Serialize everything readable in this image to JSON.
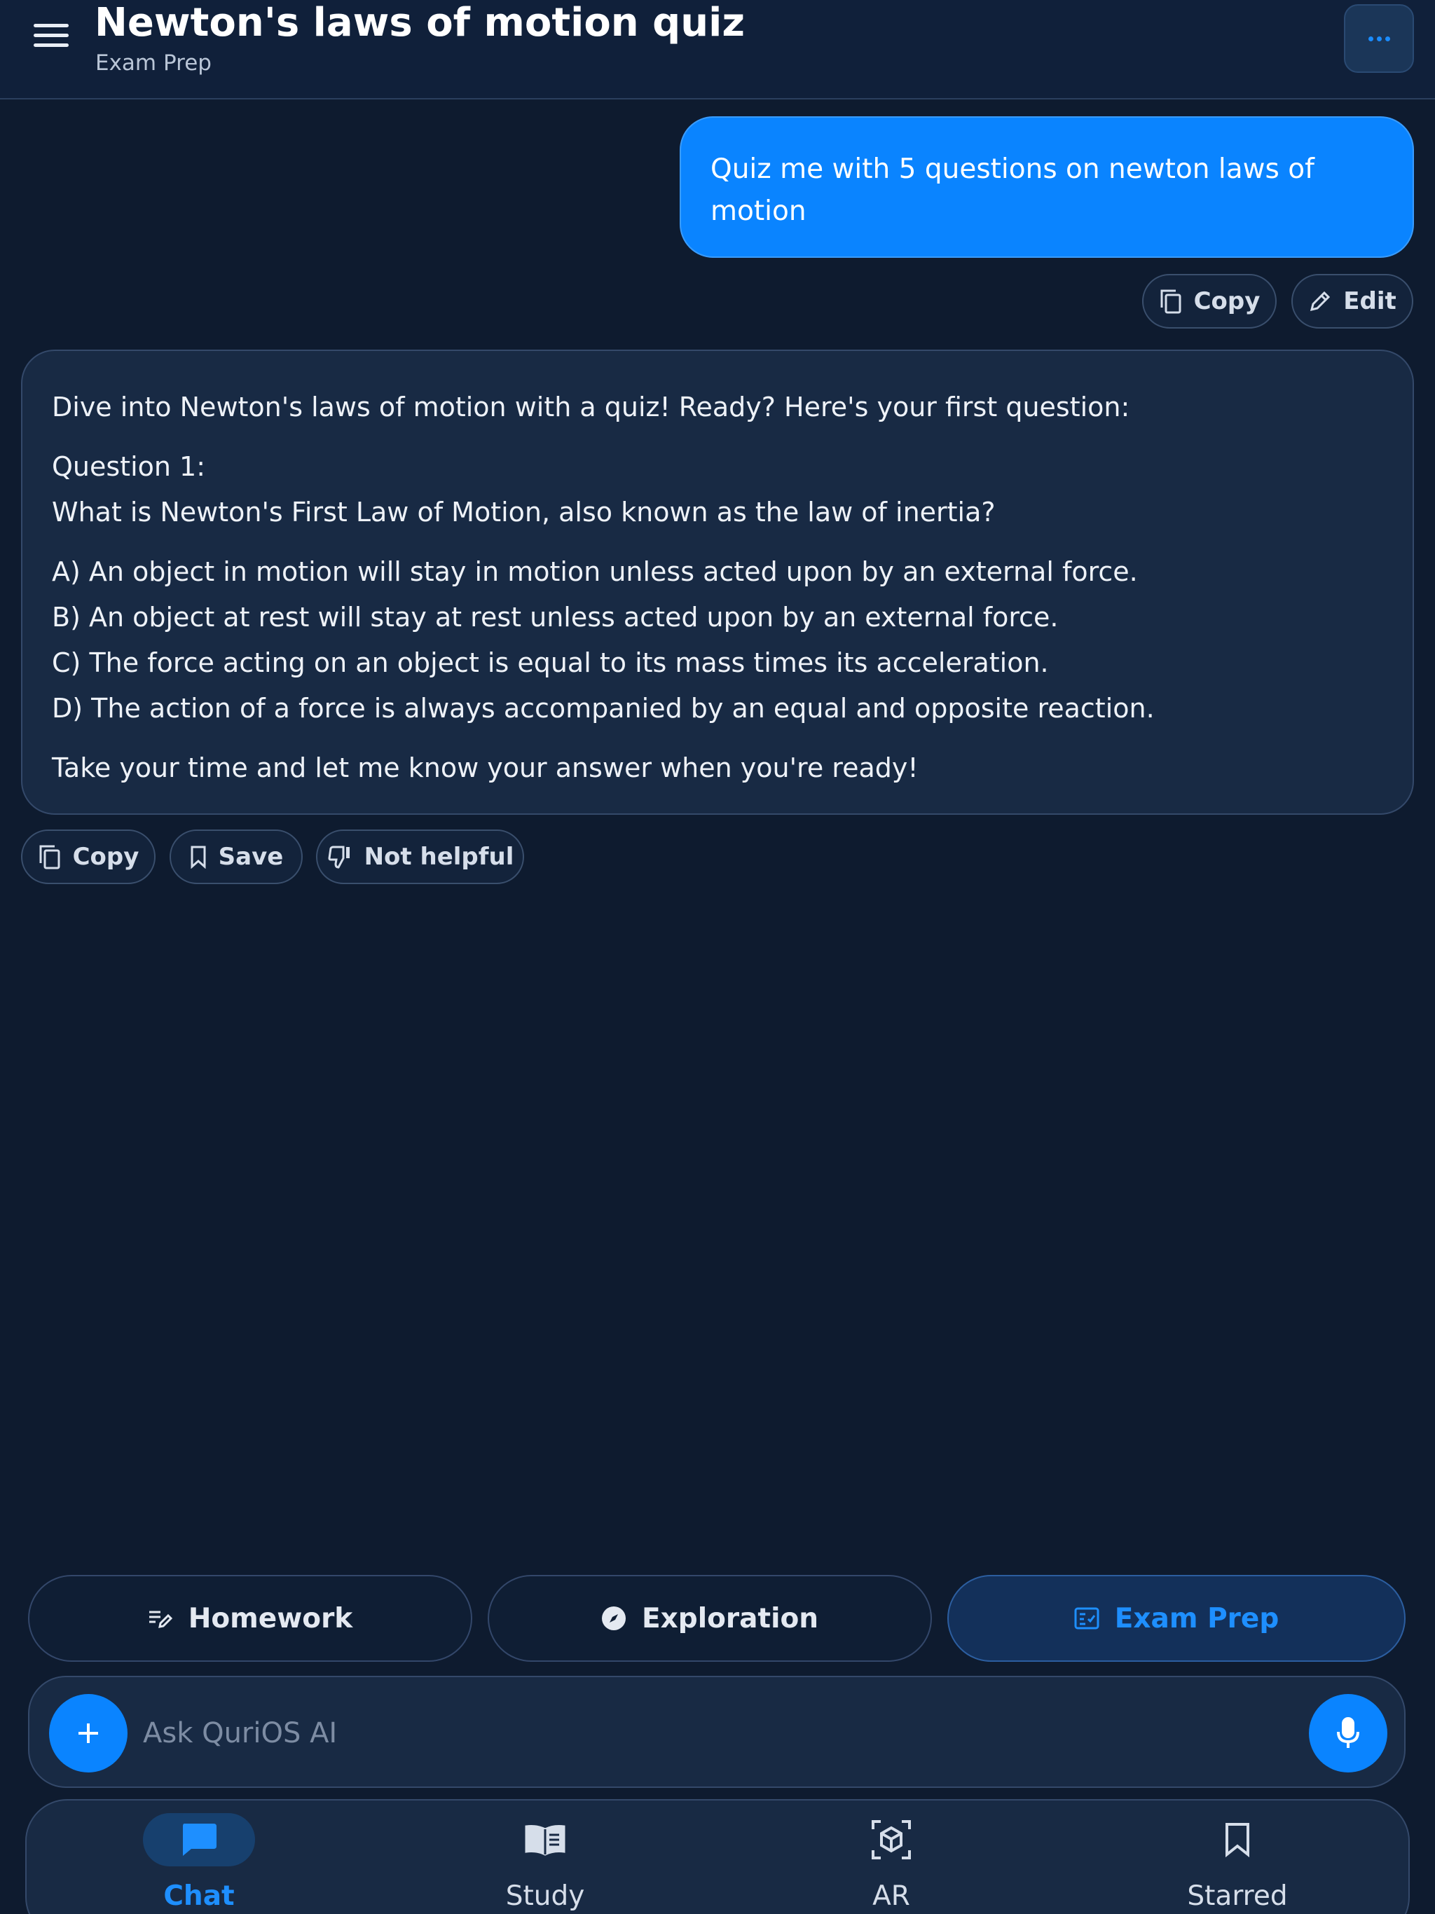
{
  "header": {
    "title": "Newton's laws of motion quiz",
    "subtitle": "Exam Prep",
    "more_icon": "ellipsis-icon"
  },
  "user_message": {
    "text": "Quiz me with 5 questions on newton laws of motion",
    "actions": {
      "copy": "Copy",
      "edit": "Edit"
    }
  },
  "ai_message": {
    "intro": "Dive into Newton's laws of motion with a quiz! Ready? Here's your first question:",
    "question_label": "Question 1:",
    "question": "What is Newton's First Law of Motion, also known as the law of inertia?",
    "options": [
      "A) An object in motion will stay in motion unless acted upon by an external force.",
      "B) An object at rest will stay at rest unless acted upon by an external force.",
      "C) The force acting on an object is equal to its mass times its acceleration.",
      "D) The action of a force is always accompanied by an equal and opposite reaction."
    ],
    "closing": "Take your time and let me know your answer when you're ready!",
    "actions": {
      "copy": "Copy",
      "save": "Save",
      "not_helpful": "Not helpful"
    }
  },
  "modes": [
    {
      "label": "Homework",
      "icon": "homework-icon",
      "active": false
    },
    {
      "label": "Exploration",
      "icon": "compass-icon",
      "active": false
    },
    {
      "label": "Exam Prep",
      "icon": "exam-checklist-icon",
      "active": true
    }
  ],
  "composer": {
    "placeholder": "Ask QuriOS AI"
  },
  "nav": [
    {
      "label": "Chat",
      "icon": "chat-icon",
      "active": true
    },
    {
      "label": "Study",
      "icon": "book-icon",
      "active": false
    },
    {
      "label": "AR",
      "icon": "ar-cube-icon",
      "active": false
    },
    {
      "label": "Starred",
      "icon": "bookmark-icon",
      "active": false
    }
  ],
  "colors": {
    "background": "#0e1b2f",
    "accent": "#0a84ff",
    "card": "#182a44"
  }
}
